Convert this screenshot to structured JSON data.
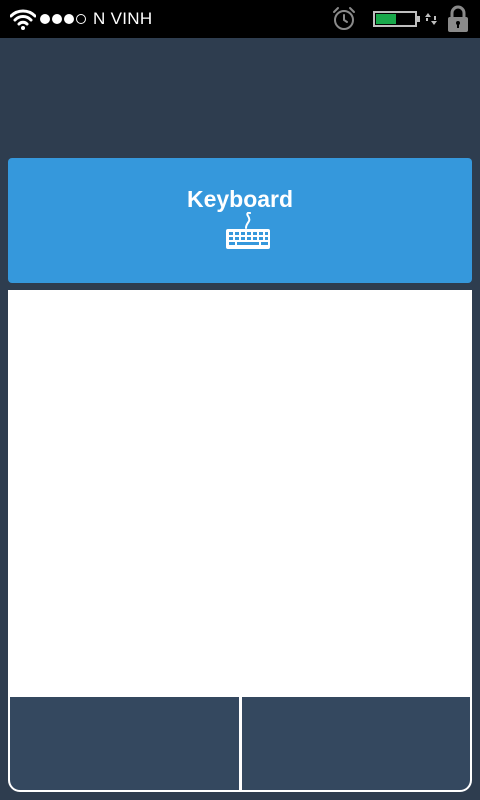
{
  "status_bar": {
    "carrier": "N VINH",
    "signal_filled": 3,
    "signal_total": 4,
    "battery_level": 0.55,
    "icons": [
      "wifi-icon",
      "alarm-icon",
      "battery-icon",
      "data-activity-icon",
      "lock-icon"
    ]
  },
  "keyboard_button": {
    "label": "Keyboard",
    "icon": "keyboard-icon"
  },
  "colors": {
    "background": "#2e3d4f",
    "accent": "#3598dc",
    "mouse_button": "#34485f",
    "touchpad": "#ffffff",
    "battery": "#19a84b"
  }
}
